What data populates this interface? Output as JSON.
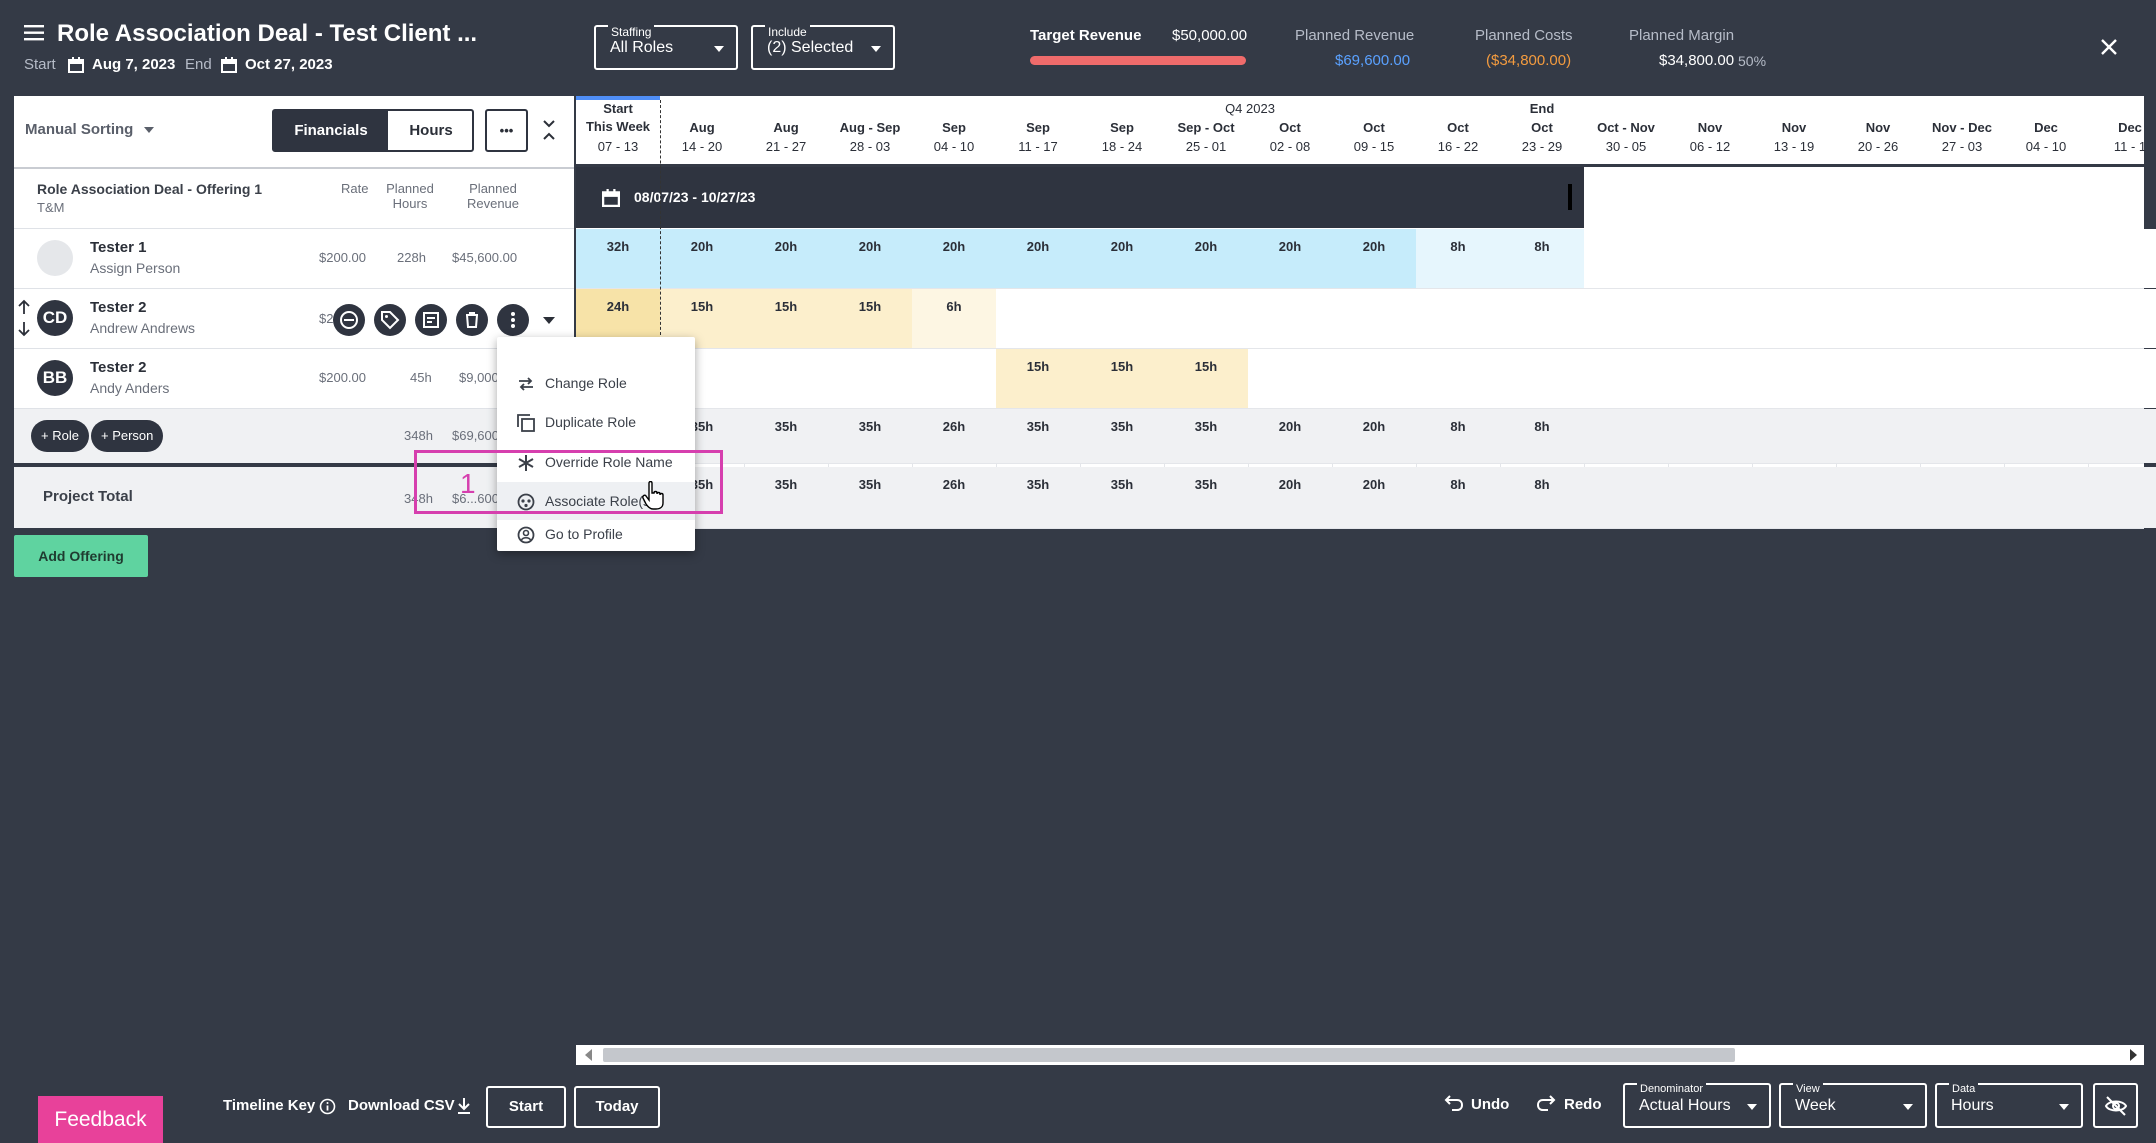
{
  "header": {
    "title": "Role Association Deal - Test Client ...",
    "start_label": "Start",
    "start_date": "Aug 7, 2023",
    "end_label": "End",
    "end_date": "Oct 27, 2023",
    "staffing": {
      "caption": "Staffing",
      "value": "All Roles"
    },
    "include": {
      "caption": "Include",
      "value": "(2) Selected"
    },
    "target_revenue": {
      "label": "Target Revenue",
      "value": "$50,000.00",
      "progress": 1.0
    },
    "planned_revenue": {
      "label": "Planned Revenue",
      "value": "$69,600.00"
    },
    "planned_costs": {
      "label": "Planned Costs",
      "value": "($34,800.00)"
    },
    "planned_margin": {
      "label": "Planned Margin",
      "value": "$34,800.00",
      "pct": "50%"
    },
    "colors": {
      "revenue": "#5aa1ff",
      "costs": "#f39b3f",
      "target_bar": "#ef6b6b"
    }
  },
  "left": {
    "sorting": "Manual Sorting",
    "tab_financials": "Financials",
    "tab_hours": "Hours",
    "more": "•••",
    "offering_title": "Role Association Deal - Offering 1",
    "offering_type": "T&M",
    "col_rate": "Rate",
    "col_hours_1": "Planned",
    "col_hours_2": "Hours",
    "col_rev_1": "Planned",
    "col_rev_2": "Revenue",
    "rows": [
      {
        "role": "Tester 1",
        "person": "Assign Person",
        "rate": "$200.00",
        "hours": "228h",
        "revenue": "$45,600.00",
        "initials": ""
      },
      {
        "role": "Tester 2",
        "person": "Andrew Andrews",
        "rate": "$2",
        "hours": "",
        "revenue": "",
        "initials": "CD"
      },
      {
        "role": "Tester 2",
        "person": "Andy Anders",
        "rate": "$200.00",
        "hours": "45h",
        "revenue": "$9,000",
        "initials": "BB"
      }
    ],
    "add_role": "+ Role",
    "add_person": "+ Person",
    "subtotal_hours": "348h",
    "subtotal_revenue": "$69,600",
    "project_total": "Project Total",
    "total_hours": "348h",
    "total_revenue": "$6...600",
    "add_offering": "Add Offering"
  },
  "timeline": {
    "columns": [
      {
        "top": "Start",
        "mid": "This Week",
        "range": "07 - 13"
      },
      {
        "top": "",
        "mid": "Aug",
        "range": "14 - 20"
      },
      {
        "top": "",
        "mid": "Aug",
        "range": "21 - 27"
      },
      {
        "top": "",
        "mid": "Aug - Sep",
        "range": "28 - 03"
      },
      {
        "top": "",
        "mid": "Sep",
        "range": "04 - 10"
      },
      {
        "top": "",
        "mid": "Sep",
        "range": "11 - 17"
      },
      {
        "top": "",
        "mid": "Sep",
        "range": "18 - 24"
      },
      {
        "top": "",
        "mid": "Sep - Oct",
        "range": "25 - 01"
      },
      {
        "top": "Q4 2023",
        "mid": "Oct",
        "range": "02 - 08"
      },
      {
        "top": "",
        "mid": "Oct",
        "range": "09 - 15"
      },
      {
        "top": "",
        "mid": "Oct",
        "range": "16 - 22"
      },
      {
        "top": "End",
        "mid": "Oct",
        "range": "23 - 29"
      },
      {
        "top": "",
        "mid": "Oct - Nov",
        "range": "30 - 05"
      },
      {
        "top": "",
        "mid": "Nov",
        "range": "06 - 12"
      },
      {
        "top": "",
        "mid": "Nov",
        "range": "13 - 19"
      },
      {
        "top": "",
        "mid": "Nov",
        "range": "20 - 26"
      },
      {
        "top": "",
        "mid": "Nov - Dec",
        "range": "27 - 03"
      },
      {
        "top": "",
        "mid": "Dec",
        "range": "04 - 10"
      },
      {
        "top": "",
        "mid": "Dec",
        "range": "11 - 1"
      }
    ],
    "date_range": "08/07/23 - 10/27/23",
    "row1": [
      "32h",
      "20h",
      "20h",
      "20h",
      "20h",
      "20h",
      "20h",
      "20h",
      "20h",
      "20h",
      "8h",
      "8h"
    ],
    "row2": [
      "24h",
      "15h",
      "15h",
      "15h",
      "6h"
    ],
    "row3": [
      "",
      "",
      "",
      "",
      "",
      "15h",
      "15h",
      "15h"
    ],
    "subtotal": [
      "",
      "35h",
      "35h",
      "35h",
      "26h",
      "35h",
      "35h",
      "35h",
      "20h",
      "20h",
      "8h",
      "8h"
    ],
    "total": [
      "",
      "35h",
      "35h",
      "35h",
      "26h",
      "35h",
      "35h",
      "35h",
      "20h",
      "20h",
      "8h",
      "8h"
    ]
  },
  "menu": {
    "items": [
      {
        "label": "Change Role",
        "icon": "swap-icon"
      },
      {
        "label": "Duplicate Role",
        "icon": "copy-icon"
      },
      {
        "label": "Override Role Name",
        "icon": "asterisk-icon"
      },
      {
        "label": "Associate Role(s)",
        "icon": "associate-icon"
      },
      {
        "label": "Go to Profile",
        "icon": "profile-icon"
      }
    ],
    "highlight_number": "1"
  },
  "bottom": {
    "feedback": "Feedback",
    "timeline_key": "Timeline Key",
    "download_csv": "Download CSV",
    "start": "Start",
    "today": "Today",
    "undo": "Undo",
    "redo": "Redo",
    "denominator": {
      "caption": "Denominator",
      "value": "Actual Hours"
    },
    "view": {
      "caption": "View",
      "value": "Week"
    },
    "data": {
      "caption": "Data",
      "value": "Hours"
    }
  }
}
